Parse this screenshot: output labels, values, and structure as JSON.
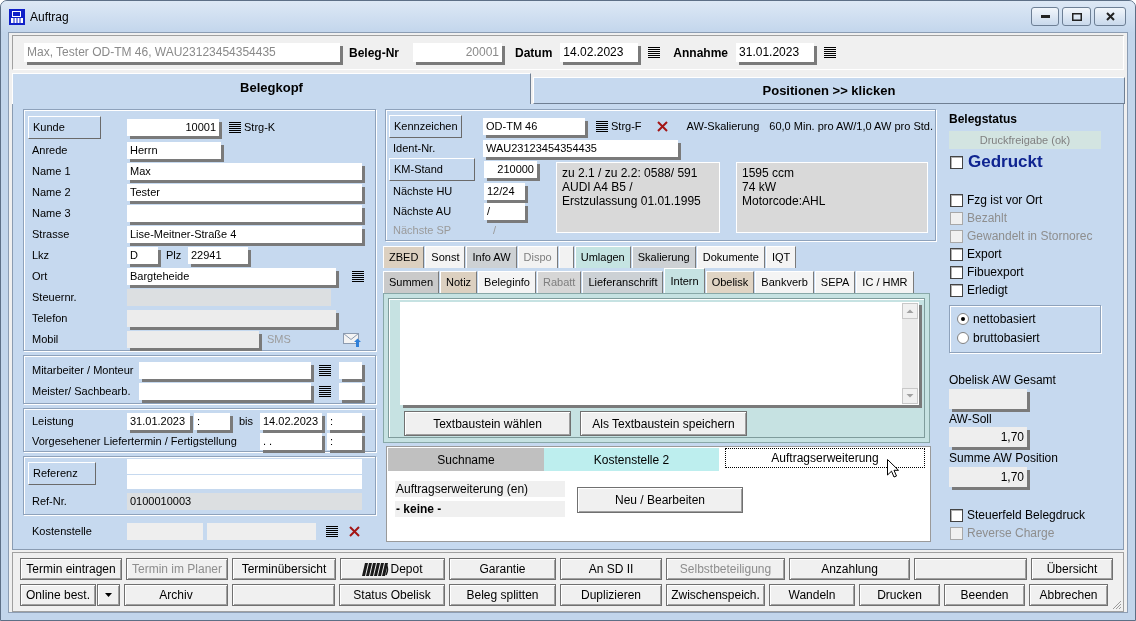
{
  "window": {
    "title": "Auftrag"
  },
  "header": {
    "summary": {
      "value": "Max, Tester OD-TM 46, WAU23123454354435",
      "disabled": true
    },
    "fields": [
      {
        "kind": "number",
        "label": "Beleg-Nr",
        "value": "20001",
        "disabled": true
      },
      {
        "kind": "date",
        "label": "Datum",
        "value": "14.02.2023",
        "disabled": false
      },
      {
        "kind": "date",
        "label": "Annahme",
        "value": "31.01.2023",
        "disabled": false
      }
    ]
  },
  "main_tabs": [
    {
      "label": "Belegkopf",
      "selected": true
    },
    {
      "label": "Positionen >> klicken",
      "selected": false
    }
  ],
  "customer": {
    "kunde": {
      "button": "Kunde",
      "value": "10001",
      "shortcut": "Strg-K"
    },
    "anrede": {
      "label": "Anrede",
      "value": "Herrn"
    },
    "name_1": {
      "label": "Name 1",
      "value": "Max"
    },
    "name_2": {
      "label": "Name 2",
      "value": "Tester"
    },
    "name_3": {
      "label": "Name 3"
    },
    "strasse": {
      "label": "Strasse",
      "value": "Lise-Meitner-Straße 4"
    },
    "lkz": {
      "label": "Lkz",
      "value": "D"
    },
    "plz": {
      "label": "Plz",
      "value": "22941"
    },
    "ort": {
      "label": "Ort",
      "value": "Bargteheide"
    },
    "steuernr": {
      "label": "Steuernr."
    },
    "telefon": {
      "label": "Telefon"
    },
    "mobil": {
      "label": "Mobil",
      "sms": "SMS"
    }
  },
  "staff": [
    {
      "label": "Mitarbeiter / Monteur"
    },
    {
      "label": "Meister/ Sachbearb."
    }
  ],
  "schedule": {
    "leistung": {
      "label": "Leistung",
      "date": "31.01.2023",
      "time": ":"
    },
    "bis": {
      "label": "bis",
      "date": "14.02.2023",
      "time": ":"
    },
    "liefertermin": {
      "label": "Vorgesehener Liefertermin / Fertigstellung",
      "date": ". .",
      "time": ":"
    }
  },
  "reference": {
    "button": "Referenz",
    "ref_nr_label": "Ref-Nr.",
    "ref_nr": "0100010003"
  },
  "kostenstelle": {
    "label": "Kostenstelle"
  },
  "vehicle": {
    "kennzeichen": {
      "button": "Kennzeichen",
      "value": "OD-TM 46",
      "shortcut": "Strg-F"
    },
    "aw_label": "AW-Skalierung",
    "aw_value": "60,0 Min. pro AW/1,0 AW pro Std.",
    "ident": {
      "label": "Ident-Nr.",
      "value": "WAU23123454354435"
    },
    "km": {
      "button": "KM-Stand",
      "value": "210000"
    },
    "hu": {
      "label": "Nächste HU",
      "value": "12/24"
    },
    "au": {
      "label": "Nächste AU",
      "value": "/"
    },
    "sp": {
      "label": "Nächste SP",
      "value": "/",
      "disabled": true
    },
    "info_lines": [
      "zu 2.1 / zu 2.2: 0588/ 591",
      "AUDI A4 B5 /",
      "Erstzulassung 01.01.1995"
    ],
    "engine_lines": [
      "1595 ccm",
      "74 kW",
      "Motorcode:AHL"
    ]
  },
  "tabs_row_1": [
    {
      "label": "ZBED",
      "selected": false,
      "disabled": false,
      "color": "#dcd0c0"
    },
    {
      "label": "Sonst",
      "selected": false,
      "disabled": false,
      "color": "#f4f4f4"
    },
    {
      "label": "Info AW",
      "selected": false,
      "disabled": false,
      "color": "#cdd1d4"
    },
    {
      "label": "Dispo",
      "selected": false,
      "disabled": true,
      "color": "#f2f2f2"
    },
    {
      "selected": false,
      "color": "#f2f2f2"
    },
    {
      "label": "Umlagen",
      "selected": false,
      "disabled": false,
      "color": "#c5e4e2"
    },
    {
      "label": "Skalierung",
      "selected": false,
      "disabled": false,
      "color": "#cdd1d4"
    },
    {
      "label": "Dokumente",
      "selected": false,
      "disabled": false,
      "color": "#f4f4f4"
    },
    {
      "label": "IQT",
      "selected": false,
      "disabled": false,
      "color": "#f4f4f4"
    }
  ],
  "tabs_row_2": [
    {
      "label": "Summen",
      "selected": false,
      "disabled": false,
      "color": "#cacaca"
    },
    {
      "label": "Notiz",
      "selected": false,
      "disabled": false,
      "color": "#dcd0c0"
    },
    {
      "label": "Beleginfo",
      "selected": false,
      "disabled": false,
      "color": "#f4f4f4"
    },
    {
      "label": "Rabatt",
      "selected": false,
      "disabled": true,
      "color": "#d6d6d6"
    },
    {
      "label": "Lieferanschrift",
      "selected": false,
      "disabled": false,
      "color": "#ccd1d5"
    },
    {
      "label": "Intern",
      "selected": true,
      "disabled": false,
      "color": "#c6e2e2"
    },
    {
      "label": "Obelisk",
      "selected": false,
      "disabled": false,
      "color": "#e0d4c4"
    },
    {
      "label": "Bankverb",
      "selected": false,
      "disabled": false,
      "color": "#f4f4f4"
    },
    {
      "label": "SEPA",
      "selected": false,
      "disabled": false,
      "color": "#f4f4f4"
    },
    {
      "label": "IC / HMR",
      "selected": false,
      "disabled": false,
      "color": "#f4f4f4"
    }
  ],
  "intern": {
    "buttons": [
      "Textbaustein wählen",
      "Als Textbaustein speichern"
    ]
  },
  "sub_tabs": [
    {
      "label": "Suchname",
      "selected": false,
      "color": "#c0c0c0"
    },
    {
      "label": "Kostenstelle 2",
      "selected": false,
      "color": "#bdeeee"
    },
    {
      "label": "Auftragserweiterung",
      "selected": true,
      "color": "#ffffff"
    }
  ],
  "extension": {
    "heading": "Auftragserweiterung (en)",
    "value": "- keine -",
    "button": "Neu / Bearbeiten"
  },
  "status": {
    "heading": "Belegstatus",
    "release": "Druckfreigabe (ok)",
    "printed": {
      "label": "Gedruckt",
      "checked": false
    },
    "flags": [
      {
        "label": "Fzg ist vor Ort",
        "checked": false,
        "disabled": false
      },
      {
        "label": "Bezahlt",
        "checked": false,
        "disabled": true
      },
      {
        "label": "Gewandelt in Stornorec",
        "checked": false,
        "disabled": true
      },
      {
        "label": "Export",
        "checked": false,
        "disabled": false
      },
      {
        "label": "Fibuexport",
        "checked": false,
        "disabled": false
      },
      {
        "label": "Erledigt",
        "checked": false,
        "disabled": false
      }
    ],
    "basis": [
      {
        "label": "nettobasiert",
        "selected": true
      },
      {
        "label": "bruttobasiert",
        "selected": false
      }
    ],
    "totals": [
      {
        "label": "Obelisk AW Gesamt"
      },
      {
        "label": "AW-Soll",
        "value": "1,70"
      },
      {
        "label": "Summe AW Position",
        "value": "1,70"
      }
    ],
    "print_flags": [
      {
        "label": "Steuerfeld Belegdruck",
        "checked": false,
        "disabled": false
      },
      {
        "label": "Reverse Charge",
        "checked": false,
        "disabled": true
      }
    ]
  },
  "toolbar": {
    "row_1": [
      {
        "kind": "plain",
        "label": "Termin eintragen",
        "disabled": false
      },
      {
        "kind": "plain",
        "label": "Termin im Planer",
        "disabled": true
      },
      {
        "kind": "plain",
        "label": "Terminübersicht",
        "disabled": false
      },
      {
        "kind": "icon",
        "label": "Depot",
        "disabled": false
      },
      {
        "kind": "plain",
        "label": "Garantie",
        "disabled": false
      },
      {
        "kind": "plain",
        "label": "An SD II",
        "disabled": false
      },
      {
        "kind": "plain",
        "label": "Selbstbeteiligung",
        "disabled": true
      },
      {
        "kind": "plain",
        "label": "Anzahlung",
        "disabled": false
      },
      {
        "kind": "blank"
      },
      {
        "kind": "plain",
        "label": "Übersicht",
        "disabled": false
      }
    ],
    "row_2": [
      {
        "kind": "split",
        "label": "Online best.",
        "disabled": false
      },
      {
        "kind": "plain",
        "label": "Archiv",
        "disabled": false
      },
      {
        "kind": "blank"
      },
      {
        "kind": "plain",
        "label": "Status Obelisk",
        "disabled": false
      },
      {
        "kind": "plain",
        "label": "Beleg splitten",
        "disabled": false
      },
      {
        "kind": "plain",
        "label": "Duplizieren",
        "disabled": false
      },
      {
        "kind": "plain",
        "label": "Zwischenspeich.",
        "disabled": false
      },
      {
        "kind": "plain",
        "label": "Wandeln",
        "disabled": false
      },
      {
        "kind": "plain",
        "label": "Drucken",
        "disabled": false
      },
      {
        "kind": "plain",
        "label": "Beenden",
        "disabled": false
      },
      {
        "kind": "plain",
        "label": "Abbrechen",
        "disabled": false
      }
    ]
  }
}
